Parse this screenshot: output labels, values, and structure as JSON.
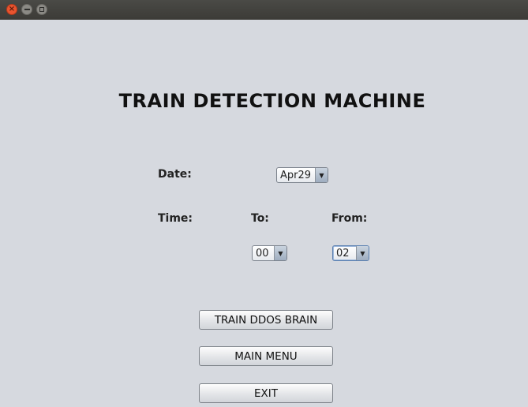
{
  "window": {
    "title": ""
  },
  "main": {
    "heading": "TRAIN DETECTION MACHINE",
    "date_label": "Date:",
    "date_value": "Apr29",
    "time_label": "Time:",
    "to_label": "To:",
    "from_label": "From:",
    "to_value": "00",
    "from_value": "02"
  },
  "buttons": {
    "train": "TRAIN DDOS BRAIN",
    "main_menu": "MAIN MENU",
    "exit": "EXIT"
  },
  "icons": {
    "close": "close-icon",
    "minimize": "minimize-icon",
    "maximize": "maximize-icon",
    "dropdown": "chevron-down-icon"
  },
  "colors": {
    "background": "#d6d9df",
    "titlebar": "#3c3b37",
    "close_button": "#e9542f"
  }
}
